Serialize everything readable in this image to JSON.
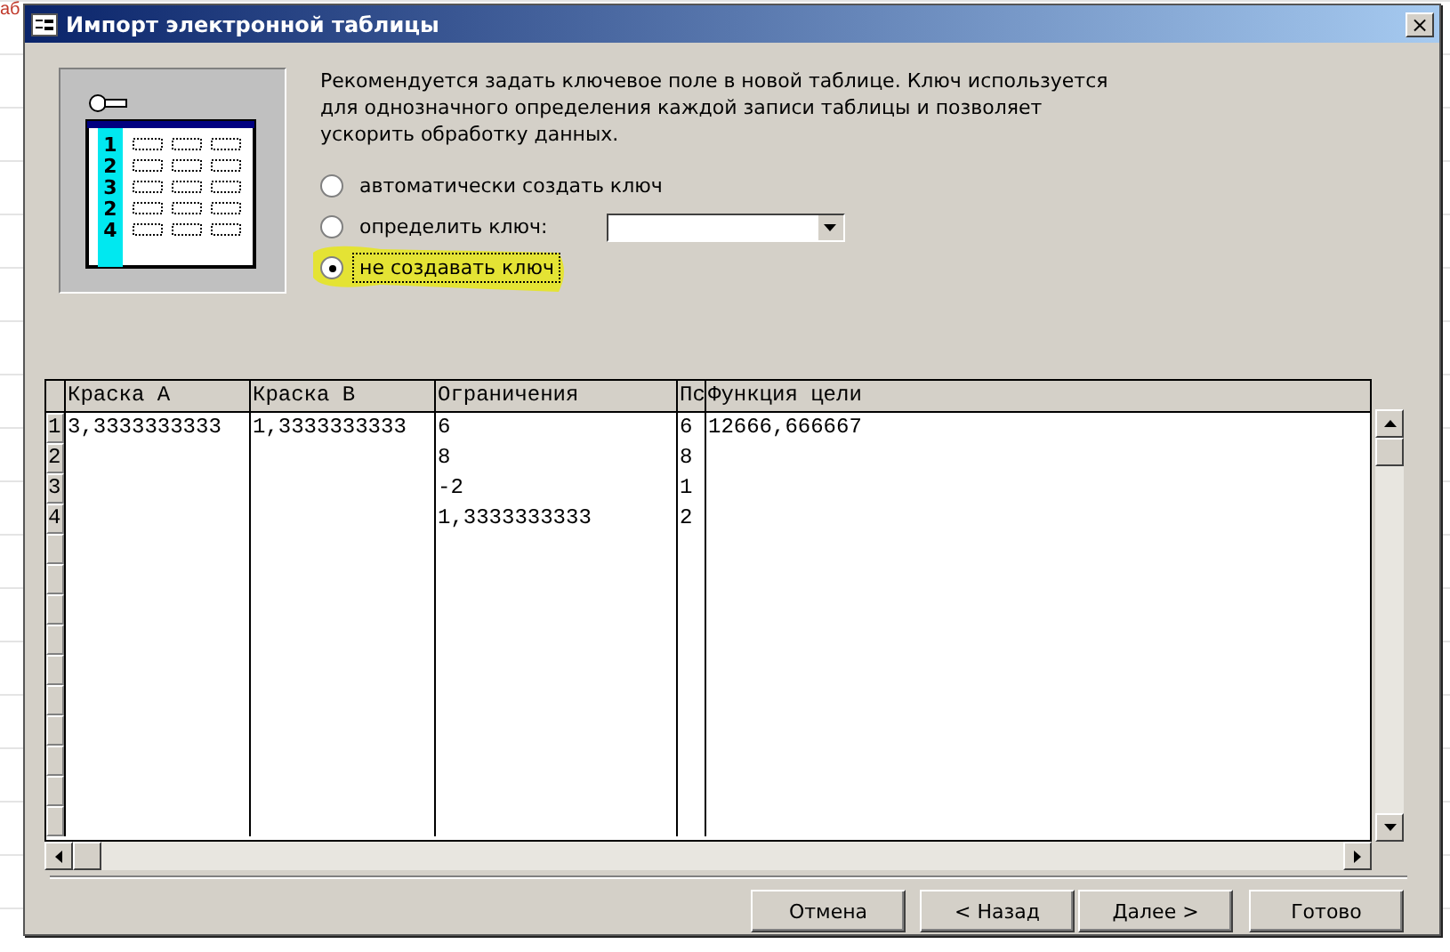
{
  "background_text": "аб",
  "window": {
    "title": "Импорт электронной таблицы",
    "close": "×"
  },
  "illustration": {
    "row_numbers": [
      "1",
      "2",
      "3",
      "2",
      "4"
    ]
  },
  "description": "Рекомендуется задать ключевое поле в новой таблице.  Ключ используется для однозначного определения каждой записи таблицы и позволяет ускорить обработку данных.",
  "options": [
    {
      "label": "автоматически создать ключ",
      "selected": false,
      "kind": "plain",
      "highlighted": false
    },
    {
      "label": "определить ключ:",
      "selected": false,
      "kind": "dropdown",
      "highlighted": false
    },
    {
      "label": "не создавать ключ",
      "selected": true,
      "kind": "plain",
      "highlighted": true
    }
  ],
  "table": {
    "columns": [
      "Краска A",
      "Краска B",
      "Ограничения",
      "Пс",
      "Функция цели"
    ],
    "rows": [
      {
        "number": "1",
        "cells": [
          "3,3333333333",
          "1,3333333333",
          "6",
          "6",
          "12666,666667"
        ]
      },
      {
        "number": "2",
        "cells": [
          "",
          "",
          "8",
          "8",
          ""
        ]
      },
      {
        "number": "3",
        "cells": [
          "",
          "",
          "-2",
          "1",
          ""
        ]
      },
      {
        "number": "4",
        "cells": [
          "",
          "",
          "1,3333333333",
          "2",
          ""
        ]
      }
    ]
  },
  "buttons": [
    {
      "label": "Отмена",
      "kind": "cancel"
    },
    {
      "label": "< Назад",
      "kind": "back"
    },
    {
      "label": "Далее >",
      "kind": "next"
    },
    {
      "label": "Готово",
      "kind": "finish"
    }
  ]
}
